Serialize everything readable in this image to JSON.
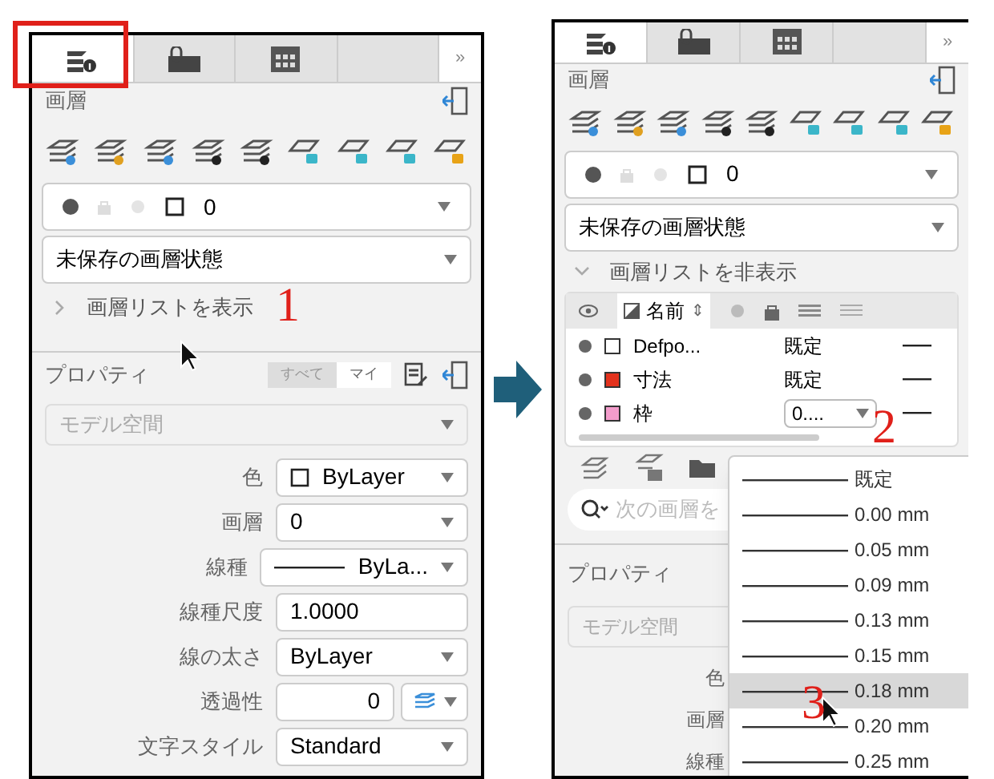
{
  "left_panel": {
    "tabs": [
      {
        "kind": "layers",
        "selected": true
      },
      {
        "kind": "attach",
        "selected": false
      },
      {
        "kind": "table",
        "selected": false
      },
      {
        "kind": "empty",
        "selected": false
      }
    ],
    "overflow": "»",
    "layer_title": "画層",
    "current_layer": "0",
    "layer_state": "未保存の画層状態",
    "layer_list_toggle": {
      "label": "画層リストを表示",
      "expanded": false
    },
    "properties": {
      "title": "プロパティ",
      "filter": [
        {
          "label": "すべて",
          "selected": false
        },
        {
          "label": "マイ",
          "selected": true
        }
      ],
      "space": "モデル空間",
      "rows": [
        {
          "label": "色",
          "kind": "color",
          "value": "ByLayer"
        },
        {
          "label": "画層",
          "kind": "dropdown",
          "value": "0"
        },
        {
          "label": "線種",
          "kind": "linetype",
          "value": "ByLa..."
        },
        {
          "label": "線種尺度",
          "kind": "text",
          "value": "1.0000"
        },
        {
          "label": "線の太さ",
          "kind": "dropdown",
          "value": "ByLayer"
        },
        {
          "label": "透過性",
          "kind": "transparency",
          "value": "0"
        },
        {
          "label": "文字スタイル",
          "kind": "dropdown",
          "value": "Standard"
        }
      ]
    }
  },
  "right_panel": {
    "tabs": [
      {
        "kind": "layers",
        "selected": true
      },
      {
        "kind": "attach",
        "selected": false
      },
      {
        "kind": "table",
        "selected": false
      },
      {
        "kind": "empty",
        "selected": false
      }
    ],
    "overflow": "»",
    "layer_title": "画層",
    "current_layer": "0",
    "layer_state": "未保存の画層状態",
    "layer_list_toggle": {
      "label": "画層リストを非表示",
      "expanded": true
    },
    "layer_table": {
      "name_column": "名前",
      "sort_icon": "⇕",
      "rows": [
        {
          "name": "Defpo...",
          "color": "#ffffff",
          "lineweight": "既定",
          "editing": false
        },
        {
          "name": "寸法",
          "color": "#e3321d",
          "lineweight": "既定",
          "editing": false
        },
        {
          "name": "枠",
          "color": "#f39ccb",
          "lineweight": "0....",
          "editing": true
        }
      ]
    },
    "search": {
      "placeholder": "次の画層を"
    },
    "properties": {
      "title": "プロパティ",
      "space": "モデル空間",
      "labels": [
        "色",
        "画層",
        "線種"
      ]
    },
    "lineweight_menu": [
      {
        "label": "既定",
        "selected": false
      },
      {
        "label": "0.00 mm",
        "selected": false
      },
      {
        "label": "0.05 mm",
        "selected": false
      },
      {
        "label": "0.09 mm",
        "selected": false
      },
      {
        "label": "0.13 mm",
        "selected": false
      },
      {
        "label": "0.15 mm",
        "selected": false
      },
      {
        "label": "0.18 mm",
        "selected": true
      },
      {
        "label": "0.20 mm",
        "selected": false
      },
      {
        "label": "0.25 mm",
        "selected": false
      }
    ]
  },
  "annotations": [
    "1",
    "2",
    "3"
  ]
}
